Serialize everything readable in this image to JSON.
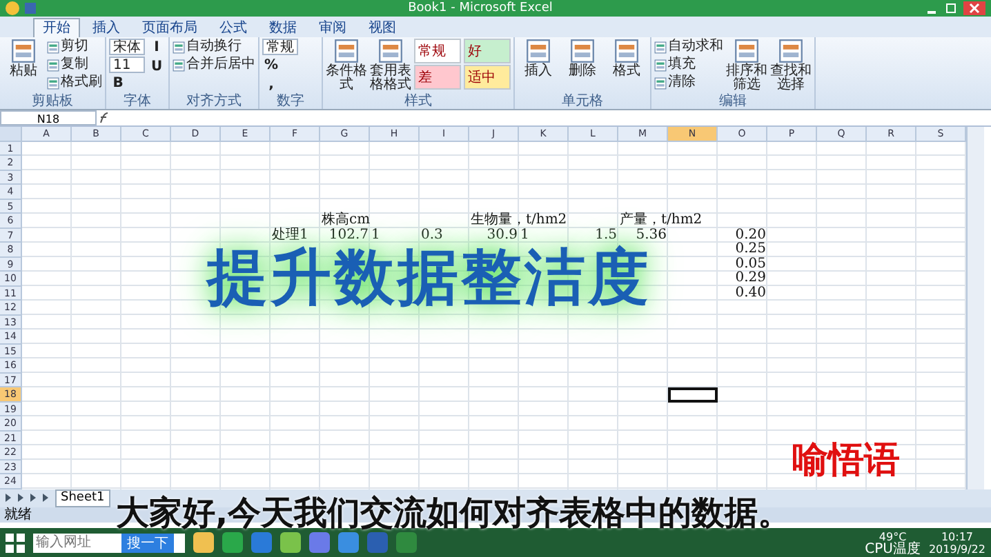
{
  "window": {
    "title": "Book1 - Microsoft Excel"
  },
  "tabs": [
    {
      "label": "开始",
      "selected": true
    },
    {
      "label": "插入",
      "selected": false
    },
    {
      "label": "页面布局",
      "selected": false
    },
    {
      "label": "公式",
      "selected": false
    },
    {
      "label": "数据",
      "selected": false
    },
    {
      "label": "审阅",
      "selected": false
    },
    {
      "label": "视图",
      "selected": false
    }
  ],
  "ribbon": [
    {
      "label": "剪贴板",
      "items": [
        {
          "kind": "large",
          "label": "粘贴"
        },
        {
          "kind": "small",
          "label": "剪切"
        },
        {
          "kind": "small",
          "label": "复制"
        },
        {
          "kind": "small",
          "label": "格式刷"
        }
      ]
    },
    {
      "label": "字体",
      "items": [
        {
          "kind": "combo",
          "label": "宋体"
        },
        {
          "kind": "combo",
          "label": "11"
        },
        {
          "kind": "toggle",
          "label": "B"
        },
        {
          "kind": "toggle",
          "label": "I"
        },
        {
          "kind": "toggle",
          "label": "U"
        }
      ]
    },
    {
      "label": "对齐方式",
      "items": [
        {
          "kind": "small",
          "label": "自动换行"
        },
        {
          "kind": "small",
          "label": "合并后居中"
        }
      ]
    },
    {
      "label": "数字",
      "items": [
        {
          "kind": "combo",
          "label": "常规"
        },
        {
          "kind": "toggle",
          "label": "%"
        },
        {
          "kind": "toggle",
          "label": ","
        }
      ]
    },
    {
      "label": "样式",
      "items": [
        {
          "kind": "large",
          "label": "条件格式"
        },
        {
          "kind": "large",
          "label": "套用表格格式"
        },
        {
          "kind": "style",
          "label": "常规",
          "color": "#ffffff"
        },
        {
          "kind": "style",
          "label": "差",
          "color": "#ffc7ce"
        },
        {
          "kind": "style",
          "label": "好",
          "color": "#c6efce"
        },
        {
          "kind": "style",
          "label": "适中",
          "color": "#ffeb9c"
        }
      ]
    },
    {
      "label": "单元格",
      "items": [
        {
          "kind": "large",
          "label": "插入"
        },
        {
          "kind": "large",
          "label": "删除"
        },
        {
          "kind": "large",
          "label": "格式"
        }
      ]
    },
    {
      "label": "编辑",
      "items": [
        {
          "kind": "small",
          "label": "自动求和"
        },
        {
          "kind": "small",
          "label": "填充"
        },
        {
          "kind": "small",
          "label": "清除"
        },
        {
          "kind": "large",
          "label": "排序和筛选"
        },
        {
          "kind": "large",
          "label": "查找和选择"
        }
      ]
    }
  ],
  "formula_bar": {
    "name_box": "N18"
  },
  "sheet": {
    "columns": [
      {
        "label": "A",
        "selected": false
      },
      {
        "label": "B",
        "selected": false
      },
      {
        "label": "C",
        "selected": false
      },
      {
        "label": "D",
        "selected": false
      },
      {
        "label": "E",
        "selected": false
      },
      {
        "label": "F",
        "selected": false
      },
      {
        "label": "G",
        "selected": false
      },
      {
        "label": "H",
        "selected": false
      },
      {
        "label": "I",
        "selected": false
      },
      {
        "label": "J",
        "selected": false
      },
      {
        "label": "K",
        "selected": false
      },
      {
        "label": "L",
        "selected": false
      },
      {
        "label": "M",
        "selected": false
      },
      {
        "label": "N",
        "selected": true
      },
      {
        "label": "O",
        "selected": false
      },
      {
        "label": "P",
        "selected": false
      },
      {
        "label": "Q",
        "selected": false
      },
      {
        "label": "R",
        "selected": false
      },
      {
        "label": "S",
        "selected": false
      }
    ],
    "rows": [
      {
        "label": "1",
        "selected": false,
        "cells": []
      },
      {
        "label": "2",
        "selected": false,
        "cells": []
      },
      {
        "label": "3",
        "selected": false,
        "cells": []
      },
      {
        "label": "4",
        "selected": false,
        "cells": []
      },
      {
        "label": "5",
        "selected": false,
        "cells": []
      },
      {
        "label": "6",
        "selected": false,
        "cells": [
          {
            "text": ""
          },
          {
            "text": ""
          },
          {
            "text": ""
          },
          {
            "text": ""
          },
          {
            "text": ""
          },
          {
            "text": ""
          },
          {
            "kind": "text",
            "text": "株高cm"
          },
          {
            "text": ""
          },
          {
            "text": ""
          },
          {
            "kind": "text",
            "text": "生物量，t/hm2"
          },
          {
            "text": ""
          },
          {
            "text": ""
          },
          {
            "kind": "text",
            "text": "产量，t/hm2"
          }
        ]
      },
      {
        "label": "7",
        "selected": false,
        "cells": [
          {
            "text": ""
          },
          {
            "text": ""
          },
          {
            "text": ""
          },
          {
            "text": ""
          },
          {
            "text": ""
          },
          {
            "kind": "text",
            "text": "处理1"
          },
          {
            "kind": "number",
            "text": "102.7"
          },
          {
            "kind": "text",
            "text": "1"
          },
          {
            "kind": "text",
            "text": "0.3"
          },
          {
            "kind": "number",
            "text": "30.9"
          },
          {
            "kind": "text",
            "text": "1"
          },
          {
            "kind": "number",
            "text": "1.5"
          },
          {
            "kind": "number",
            "text": "5.36"
          },
          {
            "text": ""
          },
          {
            "kind": "number",
            "text": "0.20"
          }
        ]
      },
      {
        "label": "8",
        "selected": false,
        "cells": [
          {
            "text": ""
          },
          {
            "text": ""
          },
          {
            "text": ""
          },
          {
            "text": ""
          },
          {
            "text": ""
          },
          {
            "text": ""
          },
          {
            "text": ""
          },
          {
            "text": ""
          },
          {
            "text": ""
          },
          {
            "text": ""
          },
          {
            "text": ""
          },
          {
            "text": ""
          },
          {
            "text": ""
          },
          {
            "text": ""
          },
          {
            "kind": "number",
            "text": "0.25"
          }
        ]
      },
      {
        "label": "9",
        "selected": false,
        "cells": [
          {
            "text": ""
          },
          {
            "text": ""
          },
          {
            "text": ""
          },
          {
            "text": ""
          },
          {
            "text": ""
          },
          {
            "text": ""
          },
          {
            "text": ""
          },
          {
            "text": ""
          },
          {
            "text": ""
          },
          {
            "text": ""
          },
          {
            "text": ""
          },
          {
            "text": ""
          },
          {
            "text": ""
          },
          {
            "text": ""
          },
          {
            "kind": "number",
            "text": "0.05"
          }
        ]
      },
      {
        "label": "10",
        "selected": false,
        "cells": [
          {
            "text": ""
          },
          {
            "text": ""
          },
          {
            "text": ""
          },
          {
            "text": ""
          },
          {
            "text": ""
          },
          {
            "text": ""
          },
          {
            "text": ""
          },
          {
            "text": ""
          },
          {
            "text": ""
          },
          {
            "text": ""
          },
          {
            "text": ""
          },
          {
            "text": ""
          },
          {
            "text": ""
          },
          {
            "text": ""
          },
          {
            "kind": "number",
            "text": "0.29"
          }
        ]
      },
      {
        "label": "11",
        "selected": false,
        "cells": [
          {
            "text": ""
          },
          {
            "text": ""
          },
          {
            "text": ""
          },
          {
            "text": ""
          },
          {
            "text": ""
          },
          {
            "text": ""
          },
          {
            "text": ""
          },
          {
            "text": ""
          },
          {
            "text": ""
          },
          {
            "text": ""
          },
          {
            "text": ""
          },
          {
            "text": ""
          },
          {
            "text": ""
          },
          {
            "text": ""
          },
          {
            "kind": "number",
            "text": "0.40"
          }
        ]
      },
      {
        "label": "12",
        "selected": false,
        "cells": []
      },
      {
        "label": "13",
        "selected": false,
        "cells": []
      },
      {
        "label": "14",
        "selected": false,
        "cells": []
      },
      {
        "label": "15",
        "selected": false,
        "cells": []
      },
      {
        "label": "16",
        "selected": false,
        "cells": []
      },
      {
        "label": "17",
        "selected": false,
        "cells": []
      },
      {
        "label": "18",
        "selected": true,
        "cells": []
      },
      {
        "label": "19",
        "selected": false,
        "cells": []
      },
      {
        "label": "20",
        "selected": false,
        "cells": []
      },
      {
        "label": "21",
        "selected": false,
        "cells": []
      },
      {
        "label": "22",
        "selected": false,
        "cells": []
      },
      {
        "label": "23",
        "selected": false,
        "cells": []
      },
      {
        "label": "24",
        "selected": false,
        "cells": []
      }
    ]
  },
  "sheet_tabs": [
    {
      "label": "Sheet1",
      "selected": true
    }
  ],
  "status_bar": {
    "text": "就绪"
  },
  "overlay": {
    "title": "提升数据整洁度",
    "caption": "大家好,今天我们交流如何对齐表格中的数据。",
    "author": "喻悟语"
  },
  "taskbar": {
    "search_placeholder": "输入网址",
    "search_button": "搜一下",
    "temperature": "49°C",
    "temperature_label": "CPU温度",
    "time": "10:17",
    "date": "2019/9/22"
  }
}
